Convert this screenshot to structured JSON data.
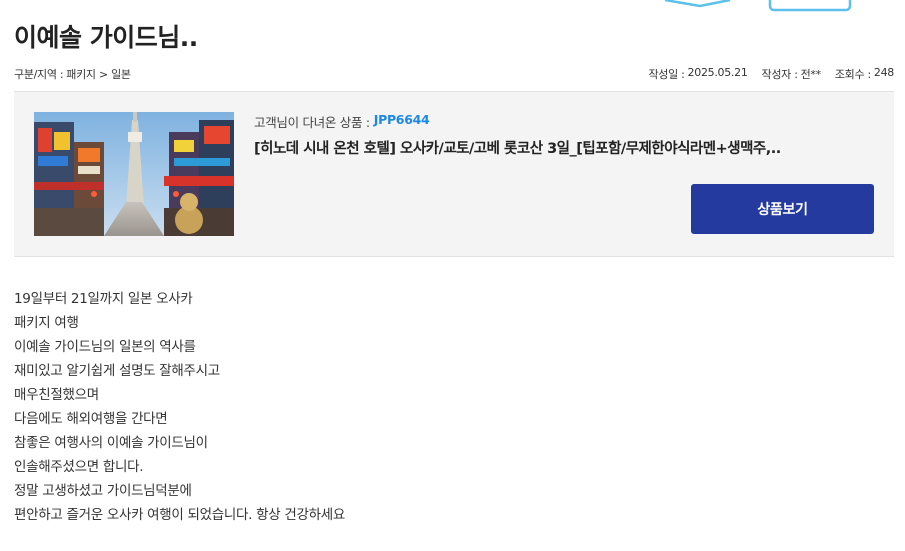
{
  "page": {
    "title": "이예솔 가이드님.."
  },
  "meta": {
    "category_label": "구분/지역 :",
    "category_value": "패키지 > 일본",
    "date_label": "작성일 :",
    "date_value": "2025.05.21",
    "author_label": "작성자 :",
    "author_value": "전**",
    "views_label": "조회수 :",
    "views_value": "248"
  },
  "product": {
    "code_label": "고객님이 다녀온 상품 :",
    "code": "JPP6644",
    "name": "[히노데 시내 온천 호텔] 오사카/교토/고베 롯코산 3일_[팁포함/무제한야식라멘+생맥주,..",
    "button_label": "상품보기",
    "image_icon": "osaka-street-photo"
  },
  "review": {
    "lines": [
      "19일부터 21일까지 일본 오사카",
      "패키지 여행",
      "이예솔 가이드님의 일본의 역사를",
      "재미있고 알기쉽게 설명도 잘해주시고",
      "매우친절했으며",
      "다음에도 해외여행을 간다면",
      "참좋은 여행사의 이예솔 가이드님이",
      "인솔해주셨으면 합니다.",
      "정말 고생하셨고 가이드님덕분에",
      "편안하고 즐거운 오사카 여행이 되었습니다. 항상 건강하세요"
    ]
  },
  "colors": {
    "accent_button": "#243a9e",
    "code_blue": "#1e88e5"
  }
}
